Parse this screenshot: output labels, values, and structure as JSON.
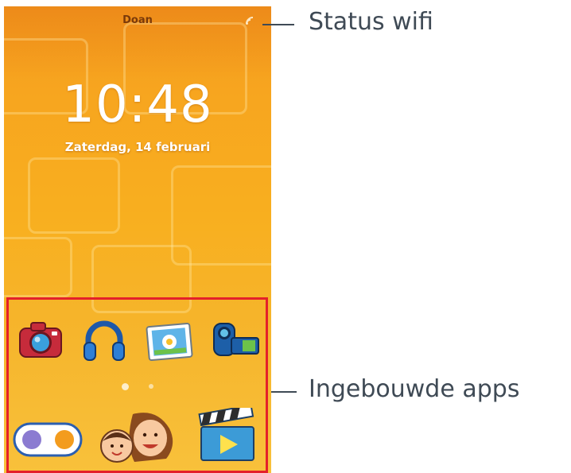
{
  "status_bar": {
    "carrier": "Doan",
    "wifi_icon": "wifi-icon"
  },
  "lockscreen": {
    "time": "10:48",
    "date": "Zaterdag, 14 februari"
  },
  "apps": [
    {
      "name": "camera",
      "icon": "camera-icon"
    },
    {
      "name": "music",
      "icon": "headphones-icon"
    },
    {
      "name": "gallery",
      "icon": "photo-icon"
    },
    {
      "name": "video-camera",
      "icon": "video-camera-icon"
    },
    {
      "name": "games",
      "icon": "gamepad-icon"
    },
    {
      "name": "contacts",
      "icon": "family-faces-icon"
    },
    {
      "name": "video-player",
      "icon": "clapperboard-icon"
    }
  ],
  "page_indicator": {
    "pages": 2,
    "current": 1
  },
  "callouts": {
    "wifi_label": "Status wifi",
    "apps_label": "Ingebouwde apps"
  },
  "colors": {
    "highlight": "#e4202a",
    "callout_text": "#3f4a55",
    "background_orange": "#f7a51f"
  }
}
